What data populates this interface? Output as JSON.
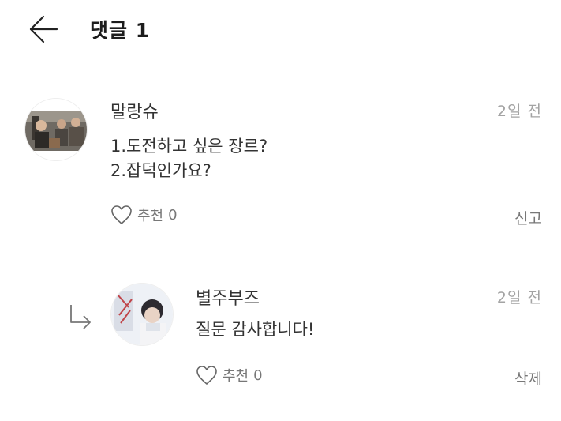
{
  "header": {
    "title": "댓글 1",
    "back_icon": "arrow-left-icon"
  },
  "comments": [
    {
      "author": "말랑슈",
      "date": "2일 전",
      "text": "1.도전하고 싶은 장르?\n2.잡덕인가요?",
      "like_label": "추천",
      "like_count": "0",
      "action": "신고"
    }
  ],
  "reply": {
    "author": "별주부즈",
    "date": "2일 전",
    "text": "질문 감사합니다!",
    "like_label": "추천",
    "like_count": "0",
    "action": "삭제"
  },
  "colors": {
    "divider": "#dcdcdc",
    "meta": "#a3a3a3",
    "text": "#333333"
  }
}
